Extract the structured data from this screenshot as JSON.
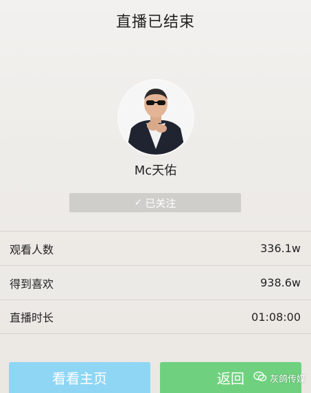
{
  "header": {
    "title": "直播已结束"
  },
  "profile": {
    "username": "Mc天佑",
    "follow_label": "已关注",
    "follow_icon": "check-icon"
  },
  "stats": [
    {
      "label": "观看人数",
      "value": "336.1w"
    },
    {
      "label": "得到喜欢",
      "value": "938.6w"
    },
    {
      "label": "直播时长",
      "value": "01:08:00"
    }
  ],
  "actions": {
    "home_label": "看看主页",
    "back_label": "返回"
  },
  "watermark": {
    "text": "灰鸽传媒",
    "icon": "wechat-icon"
  },
  "colors": {
    "home_button": "#8fd6f5",
    "back_button": "#6fd17f",
    "follow_button": "#cfcecb"
  }
}
